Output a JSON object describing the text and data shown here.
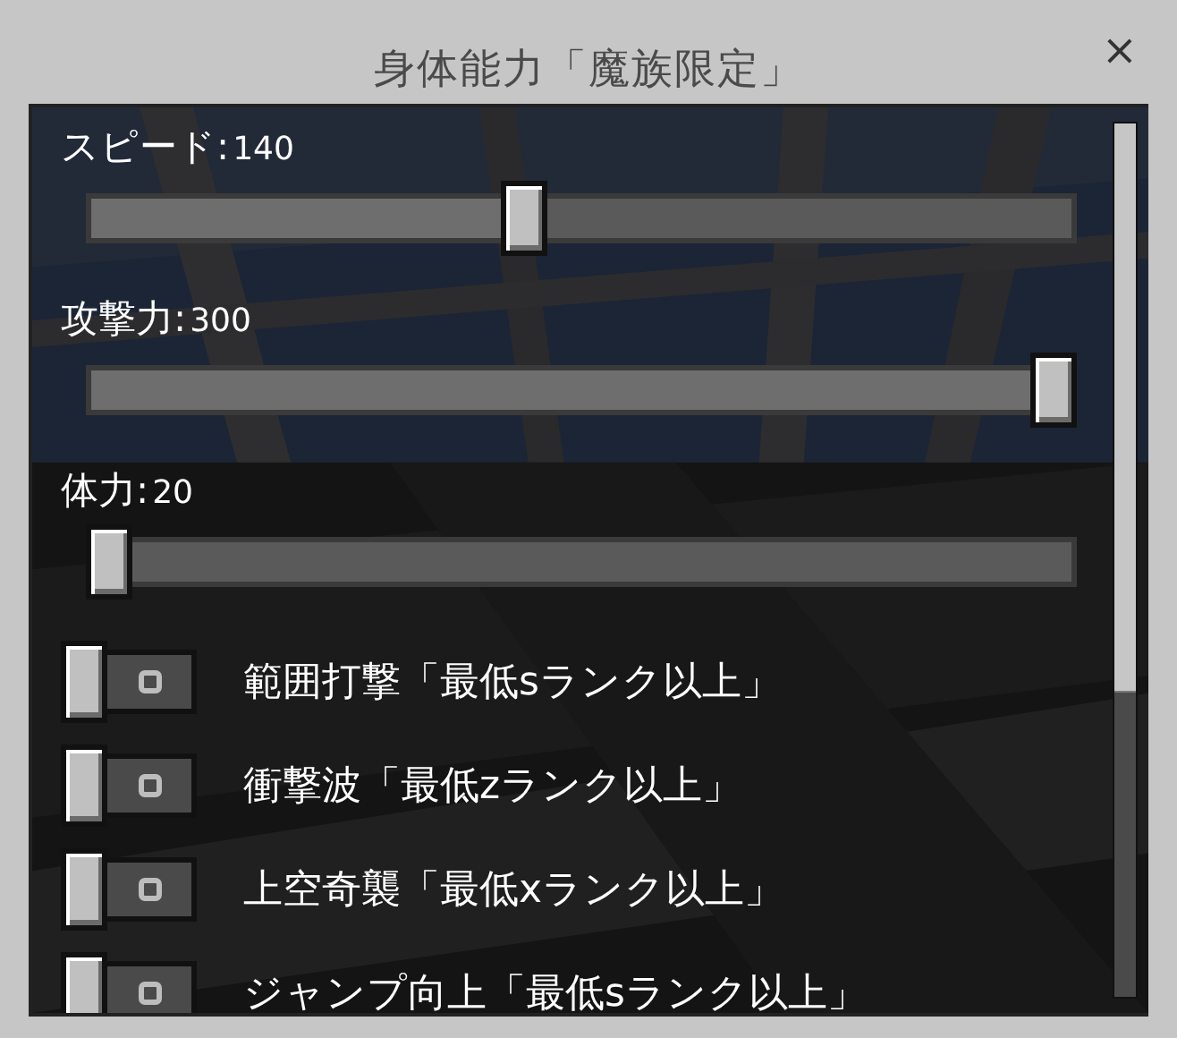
{
  "window": {
    "title": "身体能力「魔族限定」",
    "close": "×"
  },
  "controls": [
    {
      "kind": "slider",
      "label": "スピード:",
      "reading": "140",
      "level": 0.44
    },
    {
      "kind": "slider",
      "label": "攻撃力:",
      "reading": "300",
      "level": 1
    },
    {
      "kind": "slider",
      "label": "体力:",
      "reading": "20",
      "level": 0
    },
    {
      "kind": "toggle",
      "label": "範囲打撃「最低sランク以上」",
      "on": false
    },
    {
      "kind": "toggle",
      "label": "衝撃波「最低zランク以上」",
      "on": false
    },
    {
      "kind": "toggle",
      "label": "上空奇襲「最低xランク以上」",
      "on": false
    },
    {
      "kind": "toggle",
      "label": "ジャンプ向上「最低sランク以上」",
      "on": false
    }
  ]
}
